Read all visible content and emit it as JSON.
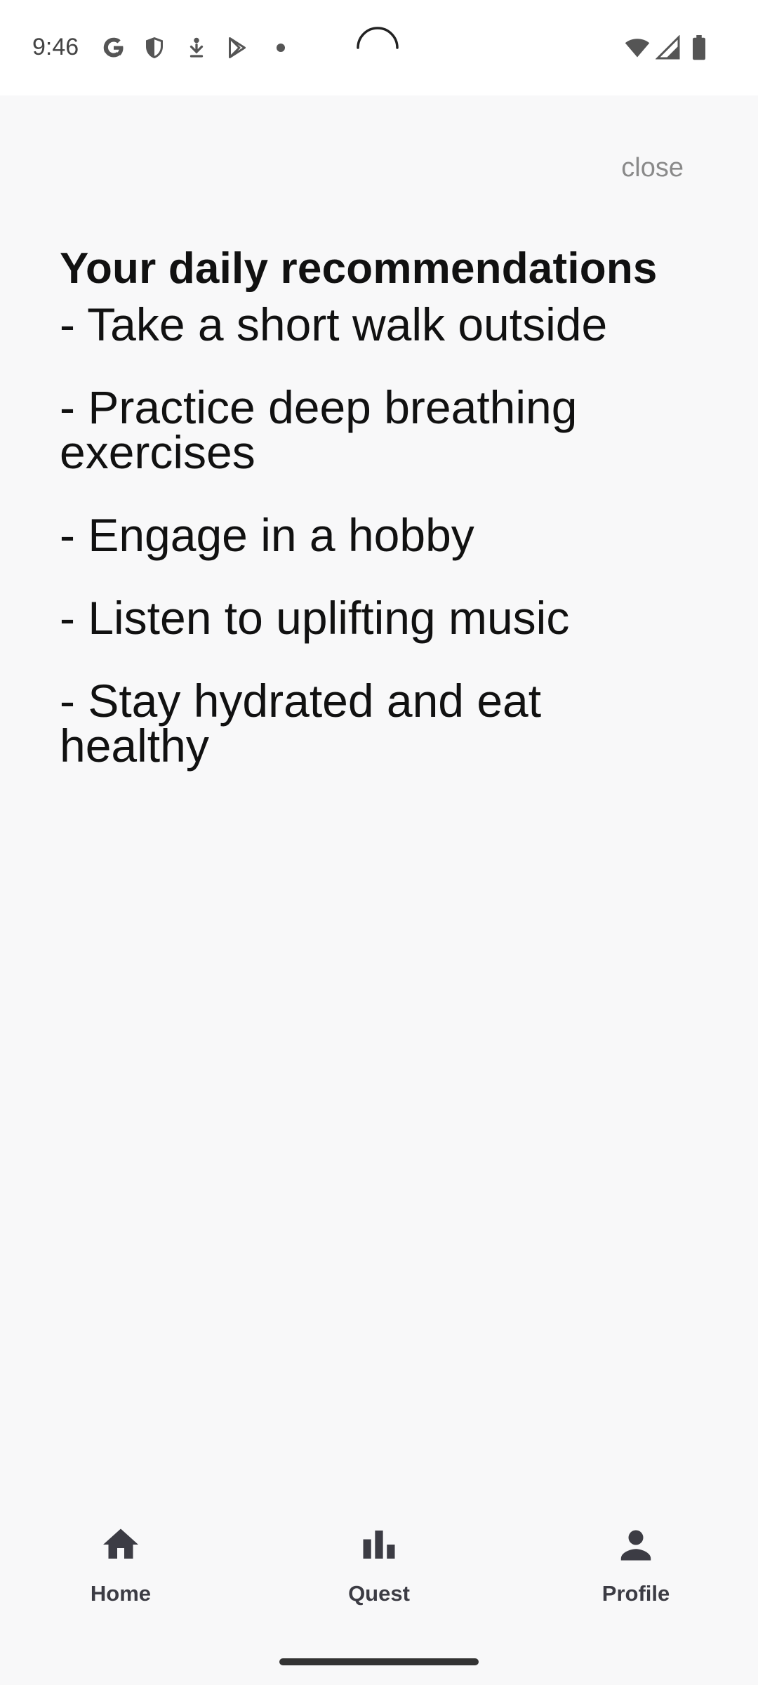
{
  "status_bar": {
    "time": "9:46",
    "icons": [
      "google-icon",
      "shield-icon",
      "download-icon",
      "play-store-icon",
      "notification-dot-icon",
      "wifi-icon",
      "signal-icon",
      "battery-icon"
    ]
  },
  "header": {
    "close_label": "close"
  },
  "main": {
    "title": "Your daily recommendations",
    "recommendations": [
      " - Take a short walk outside",
      " - Practice deep breathing exercises",
      " - Engage in a hobby",
      " - Listen to uplifting music",
      " - Stay hydrated and eat healthy"
    ]
  },
  "bottom_nav": {
    "items": [
      {
        "label": "Home",
        "icon": "home-icon"
      },
      {
        "label": "Quest",
        "icon": "bar-chart-icon"
      },
      {
        "label": "Profile",
        "icon": "person-icon"
      }
    ]
  },
  "colors": {
    "background": "#f8f8f9",
    "status_bar": "#ffffff",
    "close_text": "#8a8a8a",
    "nav_icon": "#3c3c44"
  }
}
